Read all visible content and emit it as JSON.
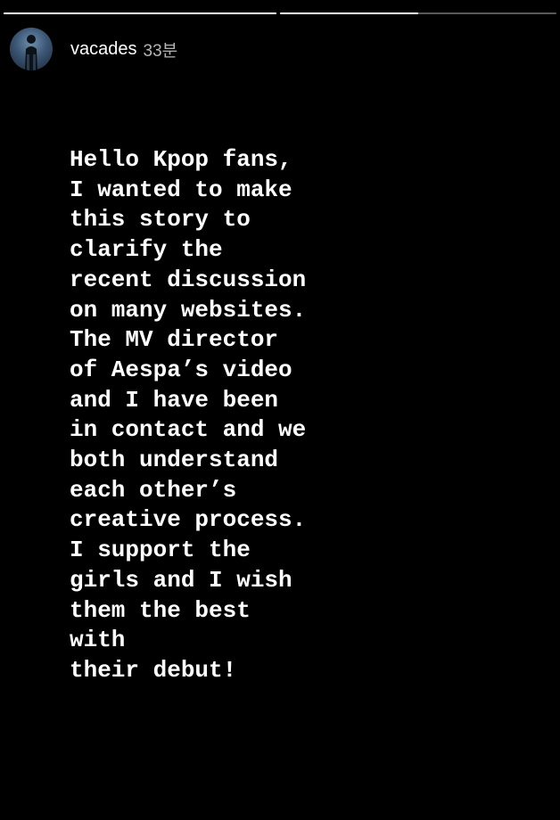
{
  "story": {
    "progress": [
      1.0,
      0.5
    ],
    "author": {
      "username": "vacades",
      "time_ago": "33분"
    },
    "text_lines": [
      "Hello Kpop fans,",
      "I wanted to make",
      "this story to",
      "clarify the",
      "recent discussion",
      "on many websites.",
      "The MV director",
      "of Aespa’s video",
      "and I have been",
      "in contact and we",
      "both understand",
      "each other’s",
      "creative process.",
      "I support the",
      "girls and I wish",
      "them the best",
      "with",
      "their debut!"
    ]
  },
  "colors": {
    "background": "#000000",
    "text": "#ffffff"
  }
}
